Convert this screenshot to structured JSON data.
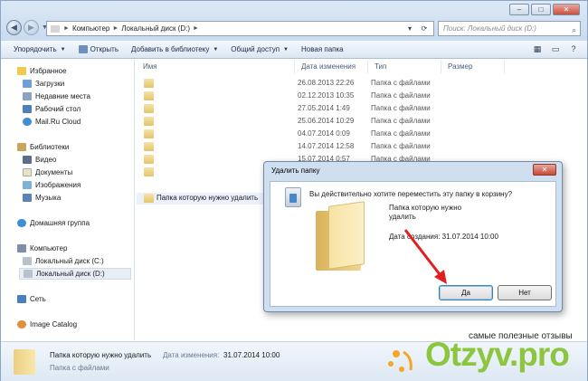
{
  "window": {
    "buttons": {
      "minimize": "–",
      "maximize": "□",
      "close": "✕"
    }
  },
  "address": {
    "crumbs": [
      "Компьютер",
      "Локальный диск (D:)"
    ]
  },
  "search": {
    "placeholder": "Поиск: Локальный диск (D:)"
  },
  "toolbar": {
    "organize": "Упорядочить",
    "open": "Открыть",
    "add_library": "Добавить в библиотеку",
    "share": "Общий доступ",
    "new_folder": "Новая папка"
  },
  "sidebar": {
    "items": [
      {
        "label": "Избранное",
        "icon": "star-icon"
      },
      {
        "label": "Загрузки",
        "icon": "downloads-icon"
      },
      {
        "label": "Недавние места",
        "icon": "recent-places-icon"
      },
      {
        "label": "Рабочий стол",
        "icon": "desktop-icon"
      },
      {
        "label": "Mail.Ru Cloud",
        "icon": "cloud-icon"
      },
      {
        "label": "Библиотеки",
        "icon": "libraries-icon"
      },
      {
        "label": "Видео",
        "icon": "video-icon"
      },
      {
        "label": "Документы",
        "icon": "documents-icon"
      },
      {
        "label": "Изображения",
        "icon": "pictures-icon"
      },
      {
        "label": "Музыка",
        "icon": "music-icon"
      },
      {
        "label": "Домашняя группа",
        "icon": "homegroup-icon"
      },
      {
        "label": "Компьютер",
        "icon": "computer-icon"
      },
      {
        "label": "Локальный диск (C:)",
        "icon": "drive-icon"
      },
      {
        "label": "Локальный диск (D:)",
        "icon": "drive-icon"
      },
      {
        "label": "Сеть",
        "icon": "network-icon"
      },
      {
        "label": "Image Catalog",
        "icon": "image-catalog-icon"
      }
    ]
  },
  "columns": {
    "name": "Имя",
    "date": "Дата изменения",
    "type": "Тип",
    "size": "Размер"
  },
  "files": [
    {
      "name": "",
      "date": "26.08.2013 22:26",
      "type": "Папка с файлами"
    },
    {
      "name": "",
      "date": "02.12.2013 10:35",
      "type": "Папка с файлами"
    },
    {
      "name": "",
      "date": "27.05.2014 1:49",
      "type": "Папка с файлами"
    },
    {
      "name": "",
      "date": "25.06.2014 10:29",
      "type": "Папка с файлами"
    },
    {
      "name": "",
      "date": "04.07.2014 0:09",
      "type": "Папка с файлами"
    },
    {
      "name": "",
      "date": "14.07.2014 12:58",
      "type": "Папка с файлами"
    },
    {
      "name": "",
      "date": "15.07.2014 0:57",
      "type": "Папка с файлами"
    },
    {
      "name": "",
      "date": "",
      "type": ""
    },
    {
      "name": "Папка которую нужно удалить",
      "date": "",
      "type": ""
    }
  ],
  "dialog": {
    "title": "Удалить папку",
    "close": "✕",
    "question": "Вы действительно хотите переместить эту папку в корзину?",
    "folder_name_line1": "Папка которую нужно",
    "folder_name_line2": "удалить",
    "created": "Дата создания: 31.07.2014 10:00",
    "yes": "Да",
    "no": "Нет"
  },
  "status": {
    "name": "Папка которую нужно удалить",
    "date_label": "Дата изменения:",
    "date_value": "31.07.2014 10:00",
    "type": "Папка с файлами"
  },
  "watermark": {
    "tagline": "самые полезные отзывы",
    "brand": "Otzyv.pro",
    "brand_color": "#8cc63f"
  },
  "colors": {
    "accent": "#c9dbef",
    "arrow": "#e02020"
  }
}
